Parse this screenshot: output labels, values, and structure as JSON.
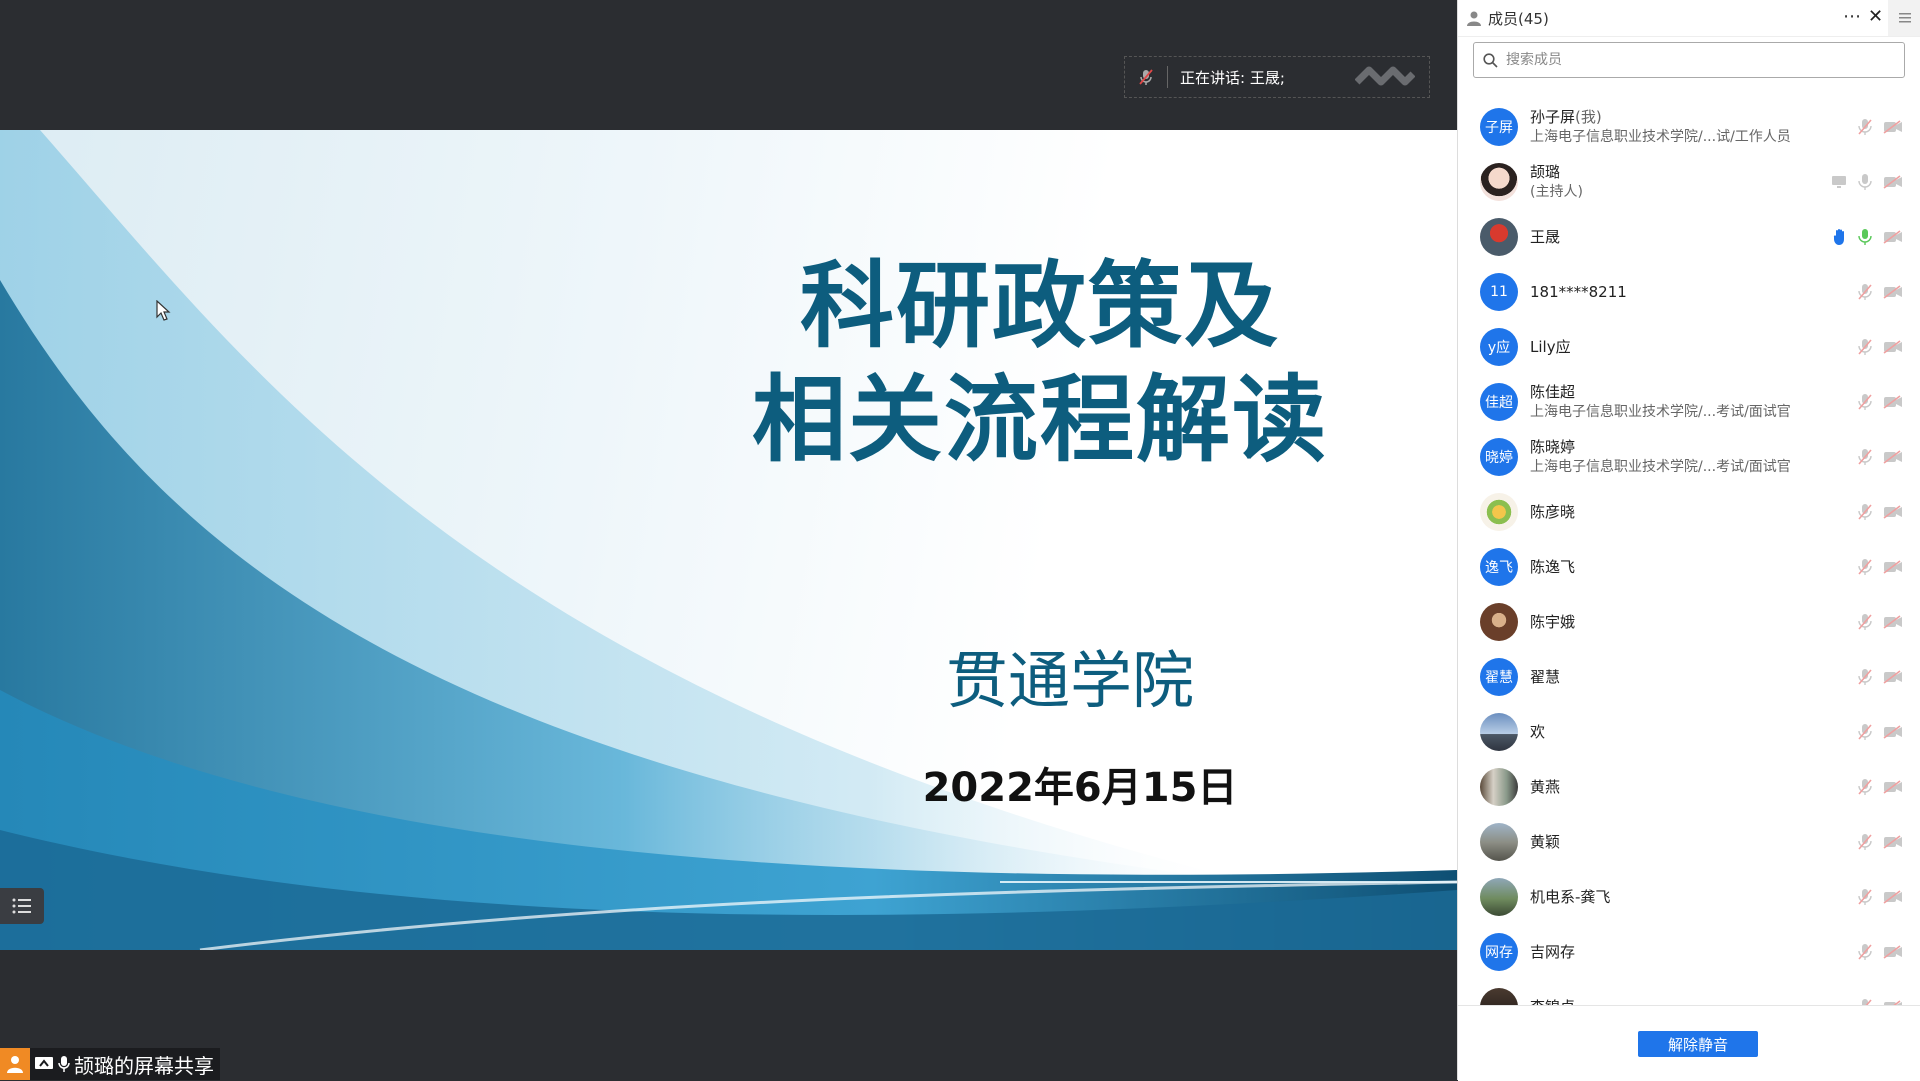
{
  "speaker_bar": {
    "label": "正在讲话: 王晟;"
  },
  "slide": {
    "title_line1": "科研政策及",
    "title_line2": "相关流程解读",
    "subtitle": "贯通学院",
    "date": "2022年6月15日"
  },
  "share_tag": {
    "label": "颉璐的屏幕共享"
  },
  "panel": {
    "title": "成员(45)",
    "search_placeholder": "搜索成员",
    "unmute_label": "解除静音",
    "members": [
      {
        "avatar_text": "子屏",
        "name": "孙子屏",
        "tag": "(我)",
        "sub": "上海电子信息职业技术学院/...试/工作人员",
        "avatar": "blue"
      },
      {
        "avatar_text": "",
        "name": "颉璐",
        "tag": "",
        "sub": "(主持人)",
        "avatar": "photo-girl"
      },
      {
        "avatar_text": "",
        "name": "王晟",
        "tag": "",
        "sub": "",
        "avatar": "photo-red"
      },
      {
        "avatar_text": "11",
        "name": "181****8211",
        "tag": "",
        "sub": "",
        "avatar": "blue"
      },
      {
        "avatar_text": "y应",
        "name": "Lily应",
        "tag": "",
        "sub": "",
        "avatar": "blue"
      },
      {
        "avatar_text": "佳超",
        "name": "陈佳超",
        "tag": "",
        "sub": "上海电子信息职业技术学院/...考试/面试官",
        "avatar": "blue"
      },
      {
        "avatar_text": "晓婷",
        "name": "陈晓婷",
        "tag": "",
        "sub": "上海电子信息职业技术学院/...考试/面试官",
        "avatar": "blue"
      },
      {
        "avatar_text": "",
        "name": "陈彦晓",
        "tag": "",
        "sub": "",
        "avatar": "photo-cartoon"
      },
      {
        "avatar_text": "逸飞",
        "name": "陈逸飞",
        "tag": "",
        "sub": "",
        "avatar": "blue"
      },
      {
        "avatar_text": "",
        "name": "陈宇娥",
        "tag": "",
        "sub": "",
        "avatar": "photo-brown"
      },
      {
        "avatar_text": "翟慧",
        "name": "翟慧",
        "tag": "",
        "sub": "",
        "avatar": "blue"
      },
      {
        "avatar_text": "",
        "name": "欢",
        "tag": "",
        "sub": "",
        "avatar": "photo-sky"
      },
      {
        "avatar_text": "",
        "name": "黄燕",
        "tag": "",
        "sub": "",
        "avatar": "photo-street"
      },
      {
        "avatar_text": "",
        "name": "黄颖",
        "tag": "",
        "sub": "",
        "avatar": "photo-city"
      },
      {
        "avatar_text": "",
        "name": "机电系-龚飞",
        "tag": "",
        "sub": "",
        "avatar": "photo-landscape"
      },
      {
        "avatar_text": "网存",
        "name": "吉网存",
        "tag": "",
        "sub": "",
        "avatar": "blue"
      },
      {
        "avatar_text": "",
        "name": "李锦卓",
        "tag": "",
        "sub": "",
        "avatar": "photo-dark"
      }
    ]
  },
  "colors": {
    "accent": "#1f75ea",
    "slide_title": "#0d5d7e",
    "panel_bg": "#ffffff",
    "stage_bg": "#2b2d31"
  }
}
